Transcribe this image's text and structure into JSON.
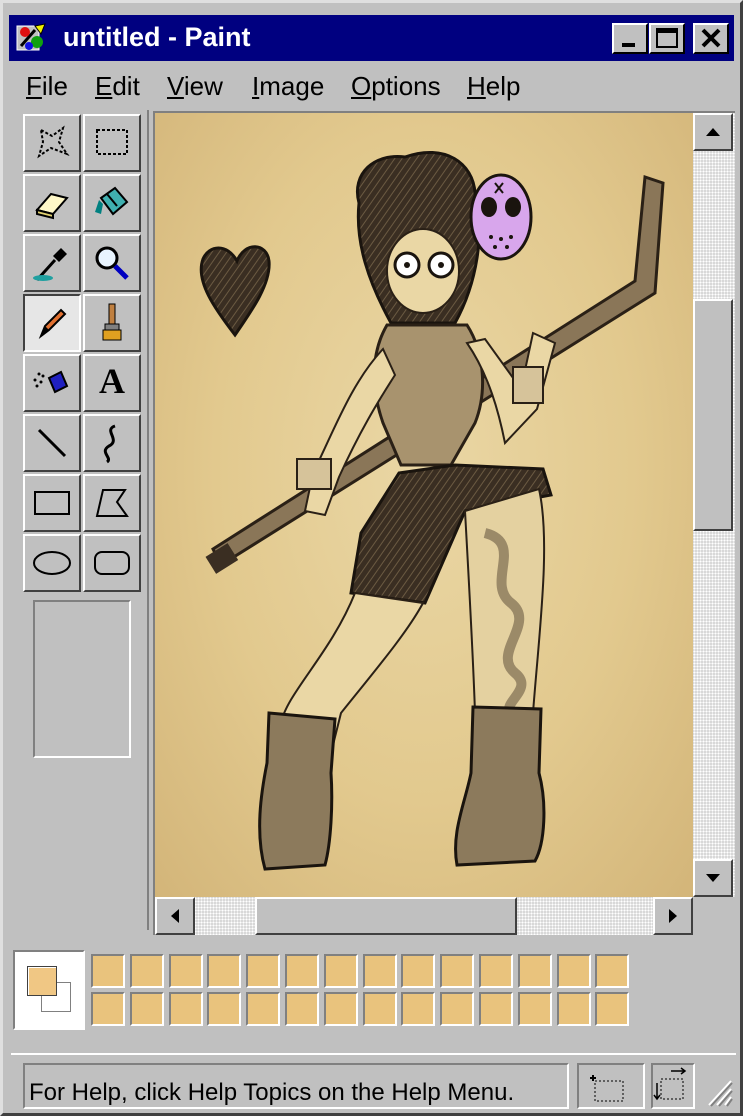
{
  "window": {
    "title": "untitled - Paint",
    "icon": "paint-app-icon",
    "controls": [
      "minimize-icon",
      "maximize-icon",
      "close-icon"
    ]
  },
  "menu": {
    "items": [
      {
        "id": "file",
        "label": "File",
        "accel": "F",
        "rest": "ile"
      },
      {
        "id": "edit",
        "label": "Edit",
        "accel": "E",
        "rest": "dit"
      },
      {
        "id": "view",
        "label": "View",
        "accel": "V",
        "rest": "iew"
      },
      {
        "id": "image",
        "label": "Image",
        "accel": "I",
        "rest": "mage"
      },
      {
        "id": "options",
        "label": "Options",
        "accel": "O",
        "rest": "ptions"
      },
      {
        "id": "help",
        "label": "Help",
        "accel": "H",
        "rest": "elp"
      }
    ]
  },
  "toolbox": {
    "tools": [
      {
        "id": "free-form-select",
        "icon": "free-form-select-icon"
      },
      {
        "id": "select",
        "icon": "rectangle-select-icon"
      },
      {
        "id": "eraser",
        "icon": "eraser-icon"
      },
      {
        "id": "fill",
        "icon": "fill-bucket-icon"
      },
      {
        "id": "pick-color",
        "icon": "eyedropper-icon"
      },
      {
        "id": "magnifier",
        "icon": "magnifier-icon"
      },
      {
        "id": "pencil",
        "icon": "pencil-icon",
        "selected": true
      },
      {
        "id": "brush",
        "icon": "brush-icon"
      },
      {
        "id": "airbrush",
        "icon": "airbrush-icon"
      },
      {
        "id": "text",
        "icon": "text-icon"
      },
      {
        "id": "line",
        "icon": "line-icon"
      },
      {
        "id": "curve",
        "icon": "curve-icon"
      },
      {
        "id": "rectangle",
        "icon": "rectangle-icon"
      },
      {
        "id": "polygon",
        "icon": "polygon-icon"
      },
      {
        "id": "ellipse",
        "icon": "ellipse-icon"
      },
      {
        "id": "rounded-rectangle",
        "icon": "rounded-rectangle-icon"
      }
    ],
    "text_tool_glyph": "A"
  },
  "colors": {
    "foreground": "#f0c784",
    "background": "#ffffff",
    "palette_fill": "#e9c37d",
    "palette_rows": 2,
    "palette_columns": 14,
    "titlebar": "#000080",
    "face": "#c0c0c0",
    "mask": "#d8a6ec"
  },
  "canvas": {
    "content": "sketch of a girl in a hockey mask holding a hockey stick, with a heart doodle"
  },
  "status": {
    "help_text": "For Help, click Help Topics on the Help Menu.",
    "position_icon": "cursor-position-icon",
    "size_icon": "selection-size-icon"
  }
}
